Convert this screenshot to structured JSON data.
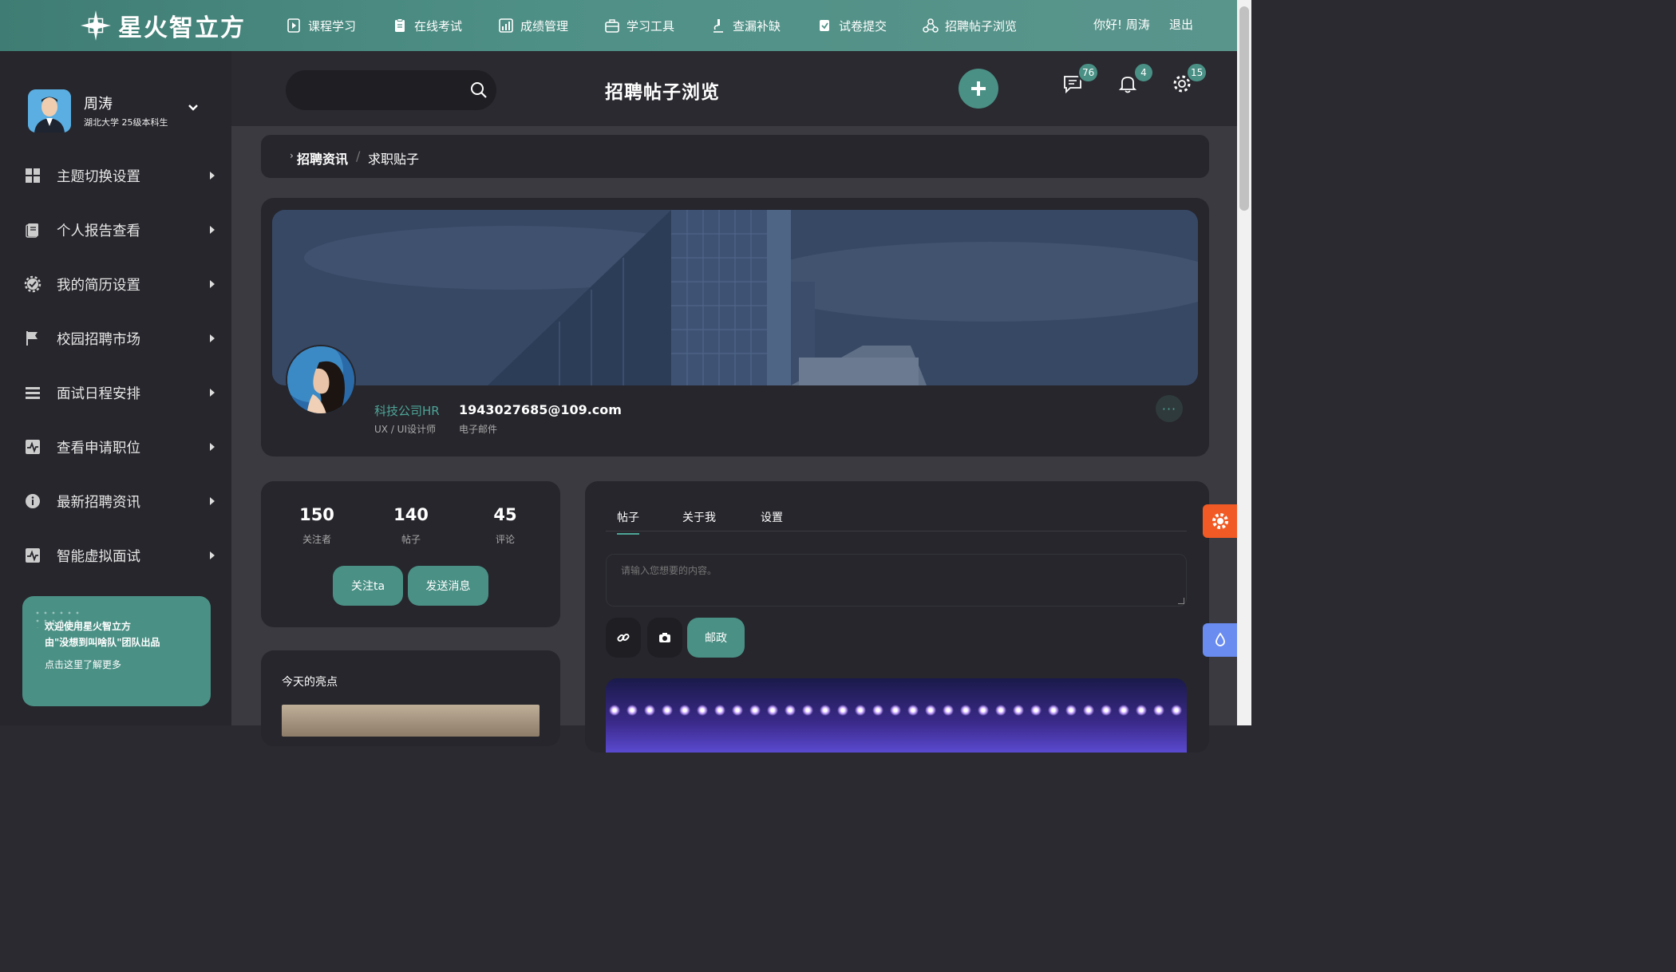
{
  "brand": {
    "name": "星火智立方"
  },
  "nav": [
    {
      "label": "课程学习",
      "icon": "play-document-icon"
    },
    {
      "label": "在线考试",
      "icon": "clipboard-icon"
    },
    {
      "label": "成绩管理",
      "icon": "bar-chart-icon"
    },
    {
      "label": "学习工具",
      "icon": "toolbox-icon"
    },
    {
      "label": "查漏补缺",
      "icon": "microscope-icon"
    },
    {
      "label": "试卷提交",
      "icon": "submit-document-icon"
    },
    {
      "label": "招聘帖子浏览",
      "icon": "network-icon"
    }
  ],
  "topbar": {
    "greeting": "你好! 周涛",
    "logout": "退出"
  },
  "user": {
    "name": "周涛",
    "subtitle": "湖北大学 25级本科生"
  },
  "menu": [
    {
      "label": "主题切换设置",
      "icon": "grid-icon"
    },
    {
      "label": "个人报告查看",
      "icon": "report-icon"
    },
    {
      "label": "我的简历设置",
      "icon": "gear-check-icon"
    },
    {
      "label": "校园招聘市场",
      "icon": "flag-icon"
    },
    {
      "label": "面试日程安排",
      "icon": "list-icon"
    },
    {
      "label": "查看申请职位",
      "icon": "activity-icon"
    },
    {
      "label": "最新招聘资讯",
      "icon": "info-icon"
    },
    {
      "label": "智能虚拟面试",
      "icon": "pulse-icon"
    }
  ],
  "promo": {
    "line1": "欢迎使用星火智立方",
    "line2": "由\"没想到叫啥队\"团队出品",
    "line3": "点击这里了解更多"
  },
  "header": {
    "title": "招聘帖子浏览",
    "badges": {
      "messages": "76",
      "notifications": "4",
      "settings": "15"
    }
  },
  "breadcrumb": {
    "parent": "招聘资讯",
    "separator": "/",
    "current": "求职贴子"
  },
  "profile": {
    "role": "科技公司HR",
    "role_sub": "UX / UI设计师",
    "email": "1943027685@109.com",
    "email_sub": "电子邮件",
    "more": "···"
  },
  "stats": [
    {
      "value": "150",
      "label": "关注者"
    },
    {
      "value": "140",
      "label": "帖子"
    },
    {
      "value": "45",
      "label": "评论"
    }
  ],
  "actions": {
    "follow": "关注ta",
    "message": "发送消息"
  },
  "highlight": {
    "title": "今天的亮点"
  },
  "post": {
    "tabs": [
      "帖子",
      "关于我",
      "设置"
    ],
    "placeholder": "请输入您想要的内容。",
    "submit": "邮政"
  },
  "colors": {
    "accent": "#4a9085",
    "sidebar": "#26262c",
    "orange": "#f15a24",
    "blue": "#6a8cf0"
  }
}
